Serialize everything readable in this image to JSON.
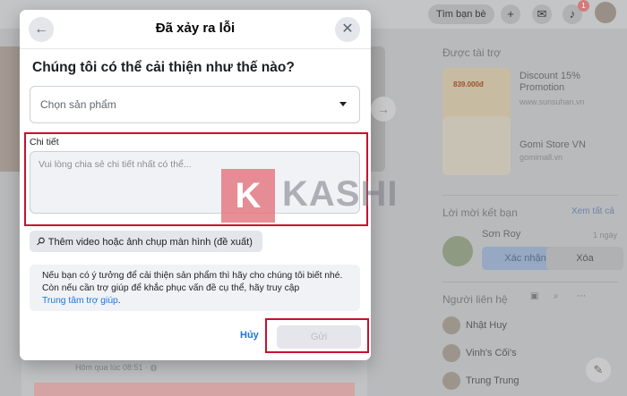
{
  "background": {
    "search_label": "Tìm bạn bè",
    "notification_count": "1",
    "sponsored_heading": "Được tài trợ",
    "ads": [
      {
        "title": "Discount 15%",
        "title2": "Promotion",
        "url": "www.sunsuhan.vn",
        "image_text": "839.000đ"
      },
      {
        "title": "Gomi Store VN",
        "url": "gomimall.vn"
      }
    ],
    "friend_requests_heading": "Lời mời kết bạn",
    "see_all": "Xem tất cả",
    "friend_name": "Sơn Roy",
    "friend_time": "1 ngày",
    "confirm_label": "Xác nhận",
    "delete_label": "Xóa",
    "contacts_heading": "Người liên hệ",
    "contacts": [
      "Nhật Huy",
      "Vinh's Cối's",
      "Trung Trung"
    ],
    "post_time": "Hôm qua lúc 08:51 · "
  },
  "dialog": {
    "title": "Đã xảy ra lỗi",
    "heading": "Chúng tôi có thể cải thiện như thế nào?",
    "product_select": "Chọn sản phẩm",
    "detail_label": "Chi tiết",
    "detail_placeholder": "Vui lòng chia sẻ chi tiết nhất có thể...",
    "attach_label": "Thêm video hoặc ảnh chụp màn hình (đề xuất)",
    "info_text": "Nếu bạn có ý tưởng để cải thiện sản phẩm thì hãy cho chúng tôi biết nhé. Còn nếu cần trợ giúp để khắc phục vấn đề cụ thể, hãy truy cập",
    "help_link": "Trung tâm trợ giúp",
    "info_end": ".",
    "cancel_label": "Hủy",
    "send_label": "Gửi"
  },
  "watermark": {
    "logo_letter": "K",
    "text": "KASHI"
  },
  "colors": {
    "accent": "#1b74e4",
    "highlight_frame": "#c8102e"
  }
}
